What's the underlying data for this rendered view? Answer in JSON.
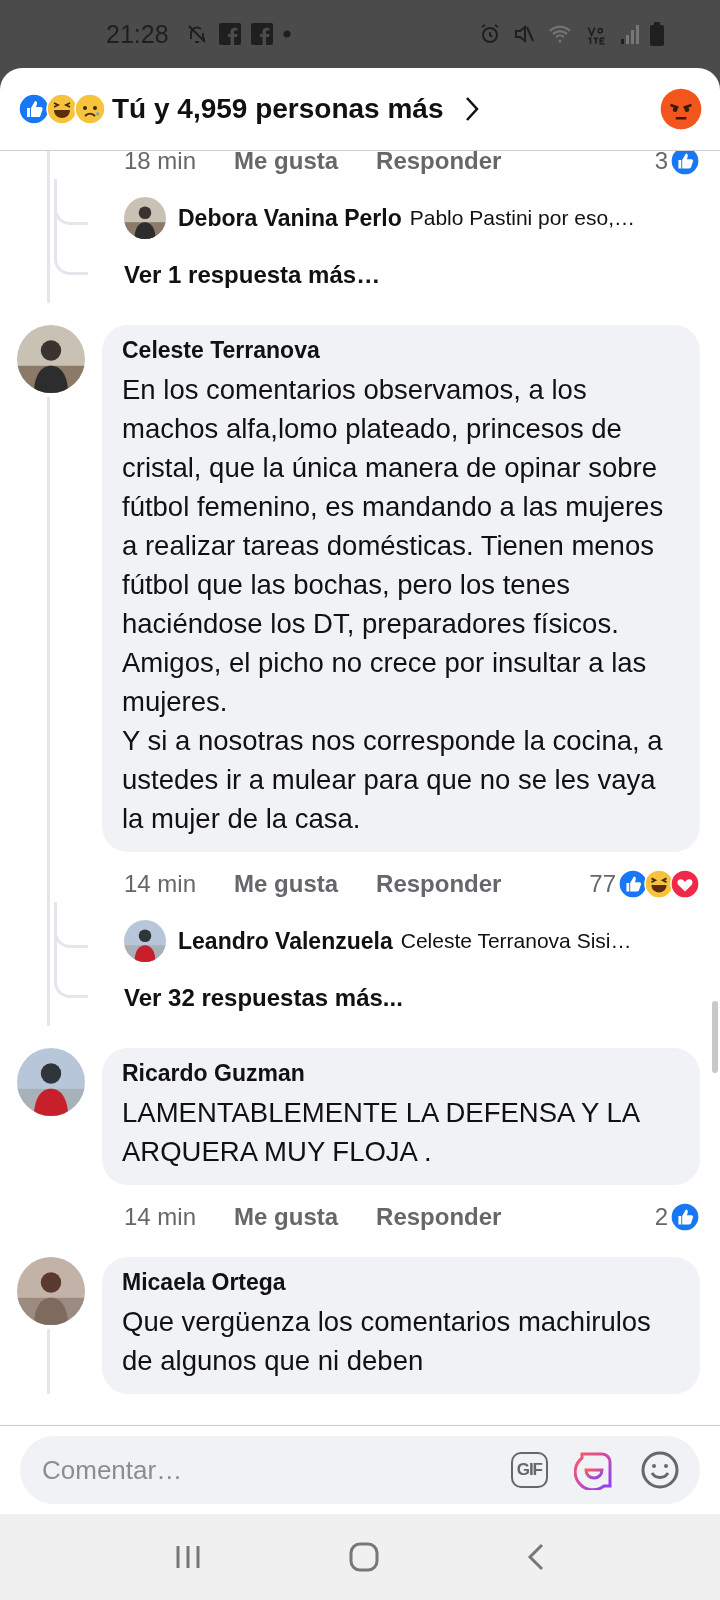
{
  "status_bar": {
    "time": "21:28"
  },
  "header": {
    "reactions": [
      {
        "kind": "like"
      },
      {
        "kind": "haha"
      },
      {
        "kind": "sad"
      }
    ],
    "text": "Tú y 4,959 personas más",
    "my_reaction": {
      "kind": "angry"
    }
  },
  "threads": [
    {
      "kind": "partial",
      "time": "18 min",
      "like": "Me gusta",
      "reply": "Responder",
      "count": "3",
      "reactions": [
        {
          "kind": "like"
        }
      ],
      "replies": [
        {
          "author": "Debora Vanina Perlo",
          "text": "Pablo Pastini por eso,…"
        }
      ],
      "more": "Ver 1 respuesta más…"
    },
    {
      "kind": "full",
      "author": "Celeste Terranova",
      "text": "En los comentarios observamos, a los machos alfa,lomo plateado, princesos de cristal, que la única manera de opinar sobre fútbol femenino, es mandando a las mujeres a realizar tareas domésticas. Tienen menos fútbol que las bochas, pero los tenes haciéndose los DT, preparadores físicos.\nAmigos, el picho no crece por insultar a las mujeres.\nY si a nosotras nos corresponde la cocina, a ustedes ir a mulear para que no se les vaya la mujer de la casa.",
      "time": "14 min",
      "like": "Me gusta",
      "reply": "Responder",
      "count": "77",
      "reactions": [
        {
          "kind": "like"
        },
        {
          "kind": "haha"
        },
        {
          "kind": "love"
        }
      ],
      "replies": [
        {
          "author": "Leandro Valenzuela",
          "text": "Celeste Terranova Sisi…"
        }
      ],
      "more": "Ver 32 respuestas más..."
    },
    {
      "kind": "full",
      "author": "Ricardo Guzman",
      "text": "LAMENTABLEMENTE LA DEFENSA Y LA ARQUERA MUY FLOJA .",
      "time": "14 min",
      "like": "Me gusta",
      "reply": "Responder",
      "count": "2",
      "reactions": [
        {
          "kind": "like"
        }
      ]
    },
    {
      "kind": "full",
      "author": "Micaela Ortega",
      "text": "Que vergüenza los comentarios machirulos de algunos que ni deben"
    }
  ],
  "composer": {
    "placeholder": "Comentar…",
    "gif": "GIF"
  }
}
